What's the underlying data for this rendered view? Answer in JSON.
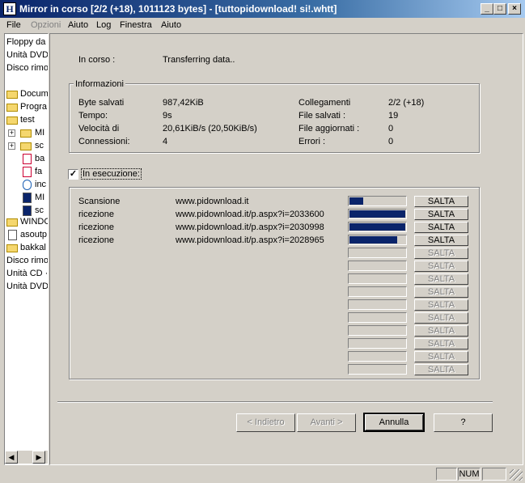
{
  "window": {
    "title": "Mirror in corso [2/2 (+18), 1011123 bytes] - [tuttopidownload! si!.whtt]",
    "icon_letter": "H",
    "min": "_",
    "max": "□",
    "close": "×"
  },
  "menu": [
    "File",
    "Opzioni",
    "Aiuto",
    "Log",
    "Finestra",
    "Aiuto"
  ],
  "sidebar": {
    "items": [
      "Floppy da",
      "Unità DVD",
      "Disco rimo",
      "Docum",
      "Progra",
      "test",
      "MI",
      "sc",
      "ba",
      "fa",
      "inc",
      "MI",
      "sc",
      "WINDO",
      "asoutp",
      "bakkal",
      "Disco rimo",
      "Unità CD ·",
      "Unità DVD"
    ],
    "scroll_left": "◀",
    "scroll_right": "▶",
    "expand": "+"
  },
  "status": {
    "label": "In corso :",
    "value": "Transferring data.."
  },
  "info": {
    "title": "Informazioni",
    "left": [
      {
        "label": "Byte salvati",
        "value": "987,42KiB"
      },
      {
        "label": "Tempo:",
        "value": "9s"
      },
      {
        "label": "Velocità di",
        "value": "20,61KiB/s (20,50KiB/s)"
      },
      {
        "label": "Connessioni:",
        "value": "4"
      }
    ],
    "right": [
      {
        "label": "Collegamenti",
        "value": "2/2 (+18)"
      },
      {
        "label": "File salvati :",
        "value": "19"
      },
      {
        "label": "File aggiornati :",
        "value": "0"
      },
      {
        "label": "Errori :",
        "value": "0"
      }
    ]
  },
  "running": {
    "label": "In esecuzione:",
    "checked": true,
    "check": "✓"
  },
  "transfers": [
    {
      "action": "Scansione",
      "url": "www.pidownload.it",
      "progress": 0.25,
      "skip": "SALTA",
      "enabled": true
    },
    {
      "action": "ricezione",
      "url": "www.pidownload.it/p.aspx?i=2033600",
      "progress": 1.0,
      "skip": "SALTA",
      "enabled": true
    },
    {
      "action": "ricezione",
      "url": "www.pidownload.it/p.aspx?i=2030998",
      "progress": 1.0,
      "skip": "SALTA",
      "enabled": true
    },
    {
      "action": "ricezione",
      "url": "www.pidownload.it/p.aspx?i=2028965",
      "progress": 0.85,
      "skip": "SALTA",
      "enabled": true
    },
    {
      "action": "",
      "url": "",
      "progress": 0,
      "skip": "SALTA",
      "enabled": false
    },
    {
      "action": "",
      "url": "",
      "progress": 0,
      "skip": "SALTA",
      "enabled": false
    },
    {
      "action": "",
      "url": "",
      "progress": 0,
      "skip": "SALTA",
      "enabled": false
    },
    {
      "action": "",
      "url": "",
      "progress": 0,
      "skip": "SALTA",
      "enabled": false
    },
    {
      "action": "",
      "url": "",
      "progress": 0,
      "skip": "SALTA",
      "enabled": false
    },
    {
      "action": "",
      "url": "",
      "progress": 0,
      "skip": "SALTA",
      "enabled": false
    },
    {
      "action": "",
      "url": "",
      "progress": 0,
      "skip": "SALTA",
      "enabled": false
    },
    {
      "action": "",
      "url": "",
      "progress": 0,
      "skip": "SALTA",
      "enabled": false
    },
    {
      "action": "",
      "url": "",
      "progress": 0,
      "skip": "SALTA",
      "enabled": false
    },
    {
      "action": "",
      "url": "",
      "progress": 0,
      "skip": "SALTA",
      "enabled": false
    }
  ],
  "buttons": {
    "back": "< Indietro",
    "next": "Avanti >",
    "cancel": "Annulla",
    "help": "?"
  },
  "statusbar": {
    "num": "NUM"
  },
  "colors": {
    "title_start": "#0a246a",
    "title_end": "#a6caf0",
    "progress": "#0a246a",
    "face": "#d4d0c8"
  }
}
